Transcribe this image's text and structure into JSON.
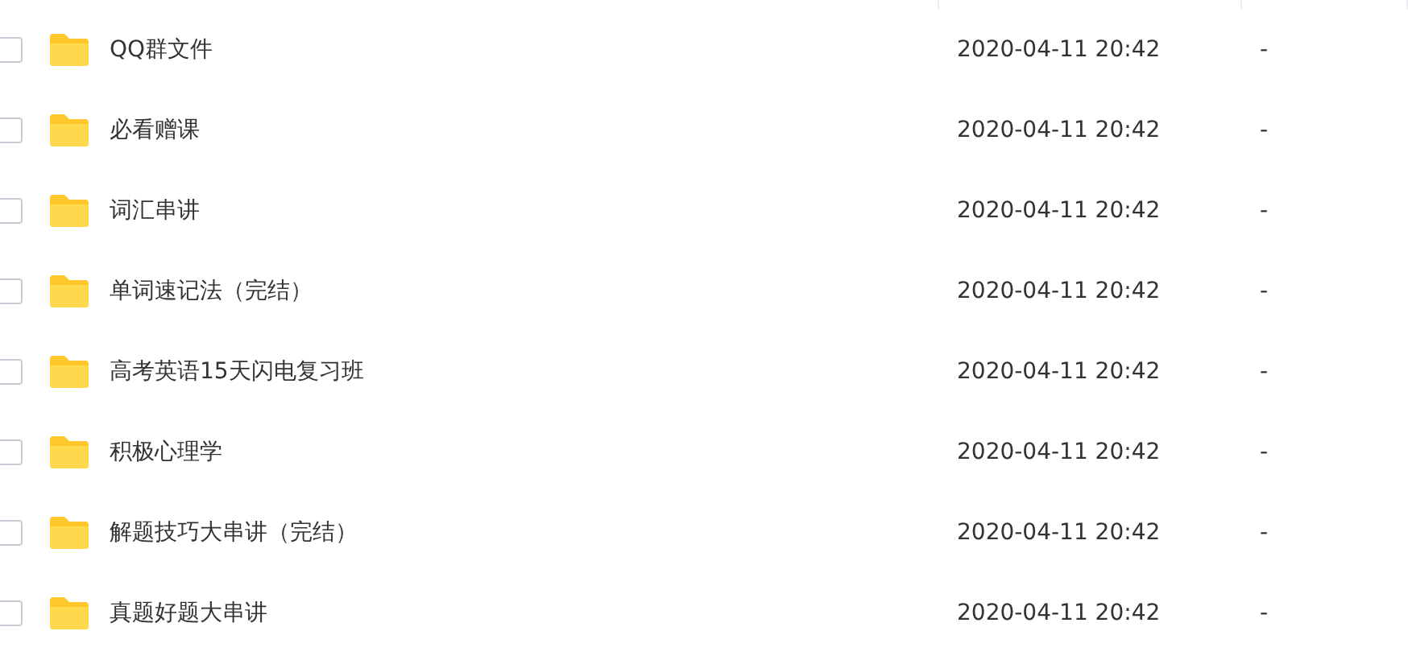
{
  "rows": [
    {
      "name": "QQ群文件",
      "date": "2020-04-11 20:42",
      "size": "-",
      "checked": false
    },
    {
      "name": "必看赠课",
      "date": "2020-04-11 20:42",
      "size": "-",
      "checked": false
    },
    {
      "name": "词汇串讲",
      "date": "2020-04-11 20:42",
      "size": "-",
      "checked": false
    },
    {
      "name": "单词速记法（完结）",
      "date": "2020-04-11 20:42",
      "size": "-",
      "checked": false
    },
    {
      "name": "高考英语15天闪电复习班",
      "date": "2020-04-11 20:42",
      "size": "-",
      "checked": false
    },
    {
      "name": "积极心理学",
      "date": "2020-04-11 20:42",
      "size": "-",
      "checked": false
    },
    {
      "name": "解题技巧大串讲（完结）",
      "date": "2020-04-11 20:42",
      "size": "-",
      "checked": false
    },
    {
      "name": "真题好题大串讲",
      "date": "2020-04-11 20:42",
      "size": "-",
      "checked": false
    }
  ]
}
